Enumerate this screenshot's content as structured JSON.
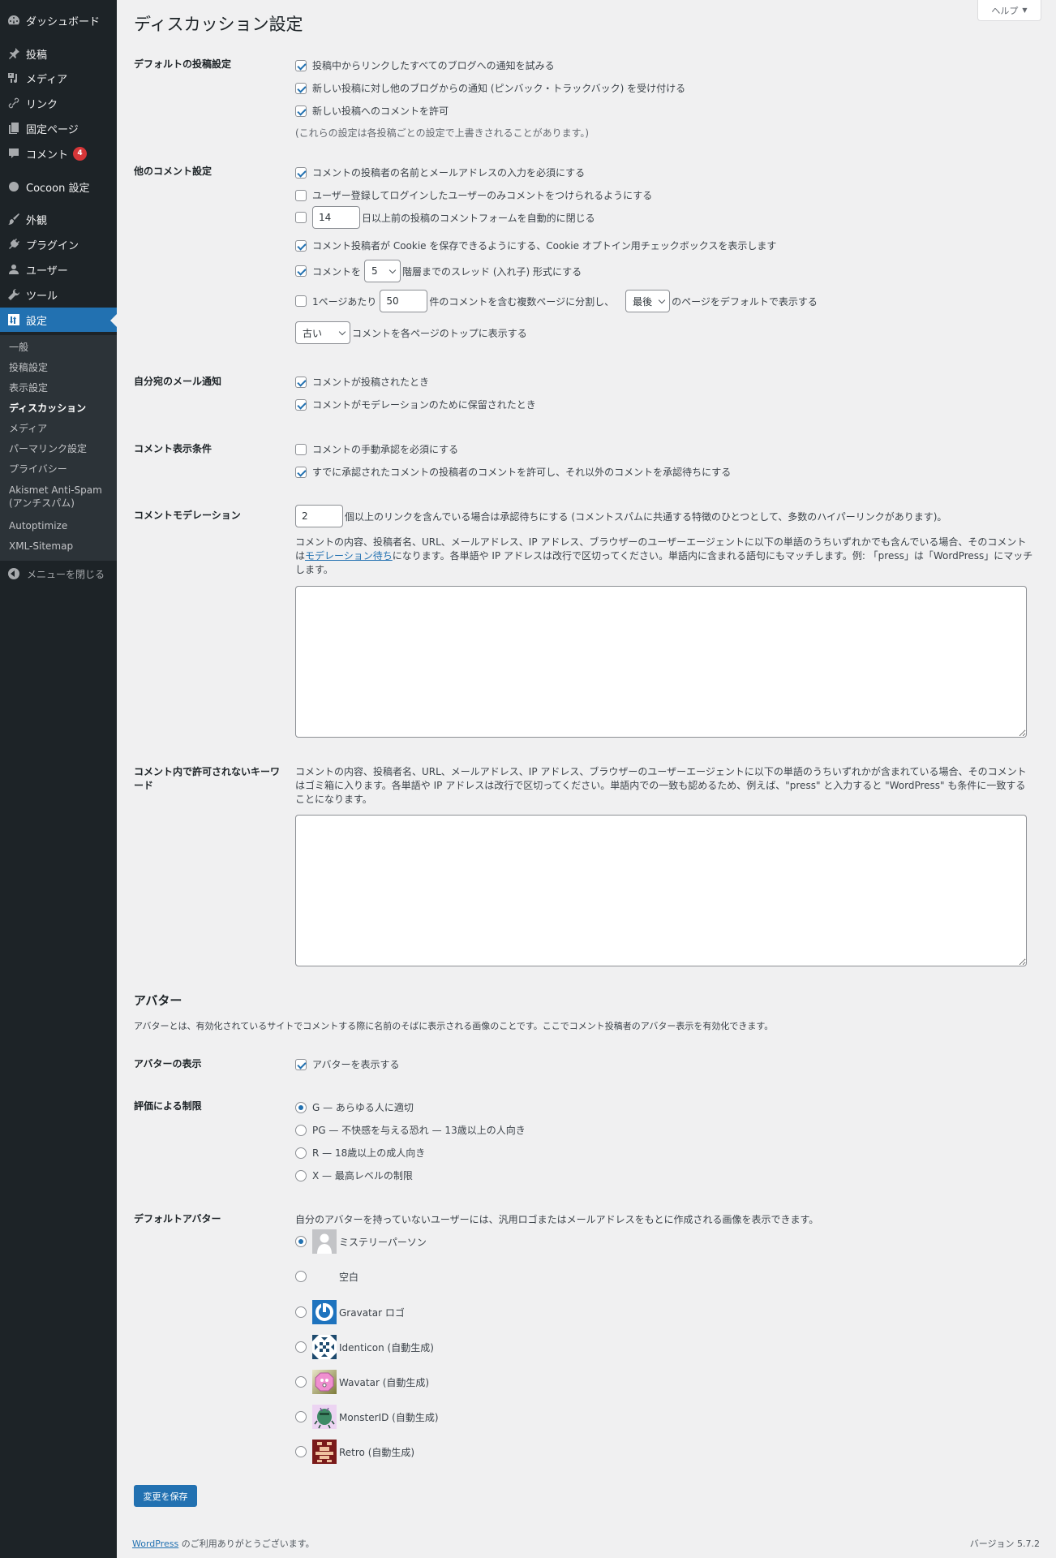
{
  "sidebar": {
    "items": [
      {
        "label": "ダッシュボード",
        "icon": "dashboard-icon"
      },
      {
        "label": "投稿",
        "icon": "pin-icon"
      },
      {
        "label": "メディア",
        "icon": "media-icon"
      },
      {
        "label": "リンク",
        "icon": "link-icon"
      },
      {
        "label": "固定ページ",
        "icon": "page-icon"
      },
      {
        "label": "コメント",
        "icon": "comment-icon",
        "badge": "4"
      },
      {
        "label": "Cocoon 設定",
        "icon": "circle-icon"
      },
      {
        "label": "外観",
        "icon": "brush-icon"
      },
      {
        "label": "プラグイン",
        "icon": "plugin-icon"
      },
      {
        "label": "ユーザー",
        "icon": "user-icon"
      },
      {
        "label": "ツール",
        "icon": "wrench-icon"
      },
      {
        "label": "設定",
        "icon": "settings-icon",
        "current": true
      }
    ],
    "submenu": [
      "一般",
      "投稿設定",
      "表示設定",
      "ディスカッション",
      "メディア",
      "パーマリンク設定",
      "プライバシー",
      "Akismet Anti-Spam",
      "(アンチスパム)",
      "Autoptimize",
      "XML-Sitemap"
    ],
    "submenu_current": "ディスカッション",
    "collapse_label": "メニューを閉じる"
  },
  "header": {
    "title": "ディスカッション設定",
    "help_label": "ヘルプ",
    "help_arrow": "▼"
  },
  "default_post": {
    "label": "デフォルトの投稿設定",
    "options": [
      {
        "label": "投稿中からリンクしたすべてのブログへの通知を試みる",
        "checked": true
      },
      {
        "label": "新しい投稿に対し他のブログからの通知 (ピンバック・トラックバック) を受け付ける",
        "checked": true
      },
      {
        "label": "新しい投稿へのコメントを許可",
        "checked": true
      }
    ],
    "note": "(これらの設定は各投稿ごとの設定で上書きされることがあります。)"
  },
  "other_comment": {
    "label": "他のコメント設定",
    "require_name_email": {
      "label": "コメントの投稿者の名前とメールアドレスの入力を必須にする",
      "checked": true
    },
    "registration_required": {
      "label": "ユーザー登録してログインしたユーザーのみコメントをつけられるようにする",
      "checked": false
    },
    "close_comments": {
      "checked": false,
      "days": "14",
      "suffix": "日以上前の投稿のコメントフォームを自動的に閉じる"
    },
    "cookies_opt_in": {
      "label": "コメント投稿者が Cookie を保存できるようにする、Cookie オプトイン用チェックボックスを表示します",
      "checked": true
    },
    "thread_comments": {
      "checked": true,
      "prefix": "コメントを",
      "depth": "5",
      "suffix": "階層までのスレッド (入れ子) 形式にする"
    },
    "page_comments": {
      "checked": false,
      "prefix": "1ページあたり",
      "per_page": "50",
      "middle": "件のコメントを含む複数ページに分割し、",
      "default_page": "最後",
      "suffix": "のページをデフォルトで表示する"
    },
    "comment_order": {
      "value": "古い",
      "suffix": "コメントを各ページのトップに表示する"
    }
  },
  "email_me": {
    "label": "自分宛のメール通知",
    "options": [
      {
        "label": "コメントが投稿されたとき",
        "checked": true
      },
      {
        "label": "コメントがモデレーションのために保留されたとき",
        "checked": true
      }
    ]
  },
  "before_comment": {
    "label": "コメント表示条件",
    "options": [
      {
        "label": "コメントの手動承認を必須にする",
        "checked": false
      },
      {
        "label": "すでに承認されたコメントの投稿者のコメントを許可し、それ以外のコメントを承認待ちにする",
        "checked": true
      }
    ]
  },
  "moderation": {
    "label": "コメントモデレーション",
    "links_value": "2",
    "links_suffix": "個以上のリンクを含んでいる場合は承認待ちにする (コメントスパムに共通する特徴のひとつとして、多数のハイパーリンクがあります)。",
    "desc_before": "コメントの内容、投稿者名、URL、メールアドレス、IP アドレス、ブラウザーのユーザーエージェントに以下の単語のうちいずれかでも含んでいる場合、そのコメントは",
    "desc_link": "モデレーション待ち",
    "desc_after": "になります。各単語や IP アドレスは改行で区切ってください。単語内に含まれる語句にもマッチします。例: 「press」は「WordPress」にマッチします。",
    "keys_value": ""
  },
  "disallowed": {
    "label": "コメント内で許可されないキーワード",
    "desc": "コメントの内容、投稿者名、URL、メールアドレス、IP アドレス、ブラウザーのユーザーエージェントに以下の単語のうちいずれかが含まれている場合、そのコメントはゴミ箱に入ります。各単語や IP アドレスは改行で区切ってください。単語内での一致も認めるため、例えば、\"press\" と入力すると \"WordPress\" も条件に一致することになります。",
    "keys_value": ""
  },
  "avatars": {
    "heading": "アバター",
    "intro": "アバターとは、有効化されているサイトでコメントする際に名前のそばに表示される画像のことです。ここでコメント投稿者のアバター表示を有効化できます。",
    "show": {
      "label": "アバターの表示",
      "option": "アバターを表示する",
      "checked": true
    },
    "rating": {
      "label": "評価による制限",
      "options": [
        {
          "label": "G — あらゆる人に適切",
          "checked": true
        },
        {
          "label": "PG — 不快感を与える恐れ — 13歳以上の人向き",
          "checked": false
        },
        {
          "label": "R — 18歳以上の成人向き",
          "checked": false
        },
        {
          "label": "X — 最高レベルの制限",
          "checked": false
        }
      ]
    },
    "default": {
      "label": "デフォルトアバター",
      "desc": "自分のアバターを持っていないユーザーには、汎用ロゴまたはメールアドレスをもとに作成される画像を表示できます。",
      "options": [
        {
          "label": "ミステリーパーソン",
          "checked": true,
          "icon": "mystery-person-avatar"
        },
        {
          "label": "空白",
          "checked": false,
          "icon": "blank-avatar"
        },
        {
          "label": "Gravatar ロゴ",
          "checked": false,
          "icon": "gravatar-logo-avatar"
        },
        {
          "label": "Identicon (自動生成)",
          "checked": false,
          "icon": "identicon-avatar"
        },
        {
          "label": "Wavatar (自動生成)",
          "checked": false,
          "icon": "wavatar-avatar"
        },
        {
          "label": "MonsterID (自動生成)",
          "checked": false,
          "icon": "monsterid-avatar"
        },
        {
          "label": "Retro (自動生成)",
          "checked": false,
          "icon": "retro-avatar"
        }
      ]
    }
  },
  "save_label": "変更を保存",
  "footer": {
    "link": "WordPress",
    "thanks": " のご利用ありがとうございます。",
    "version": "バージョン 5.7.2"
  },
  "colors": {
    "accent": "#2271b1",
    "sidebar_bg": "#1d2327",
    "submenu_bg": "#2c3338",
    "badge": "#d63638",
    "page_bg": "#f0f0f1"
  }
}
